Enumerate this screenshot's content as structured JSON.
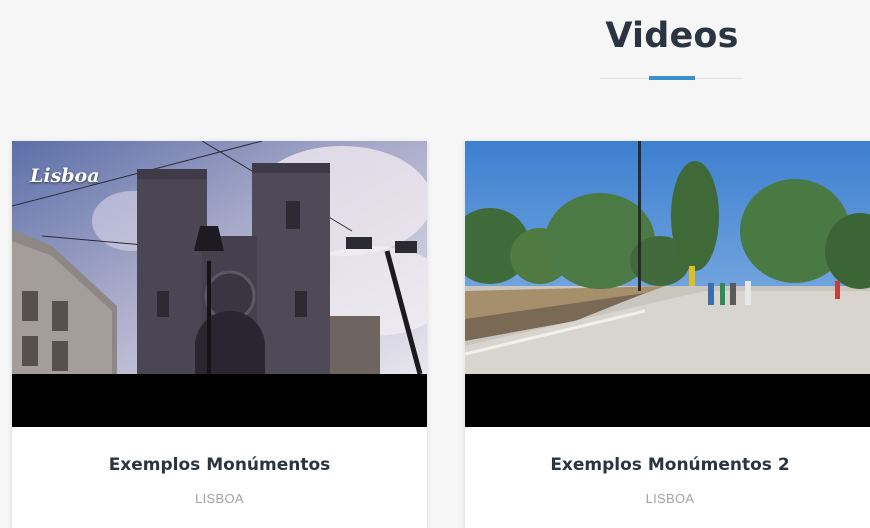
{
  "section": {
    "title": "Videos",
    "accent_color": "#3a8fd0"
  },
  "videos": [
    {
      "title": "Exemplos Monúmentos",
      "location": "LISBOA",
      "thumbnail_caption": "Lisboa",
      "thumbnail_subject": "cathedral-facade-photo"
    },
    {
      "title": "Exemplos Monúmentos 2",
      "location": "LISBOA",
      "thumbnail_subject": "public-square-photo"
    }
  ]
}
